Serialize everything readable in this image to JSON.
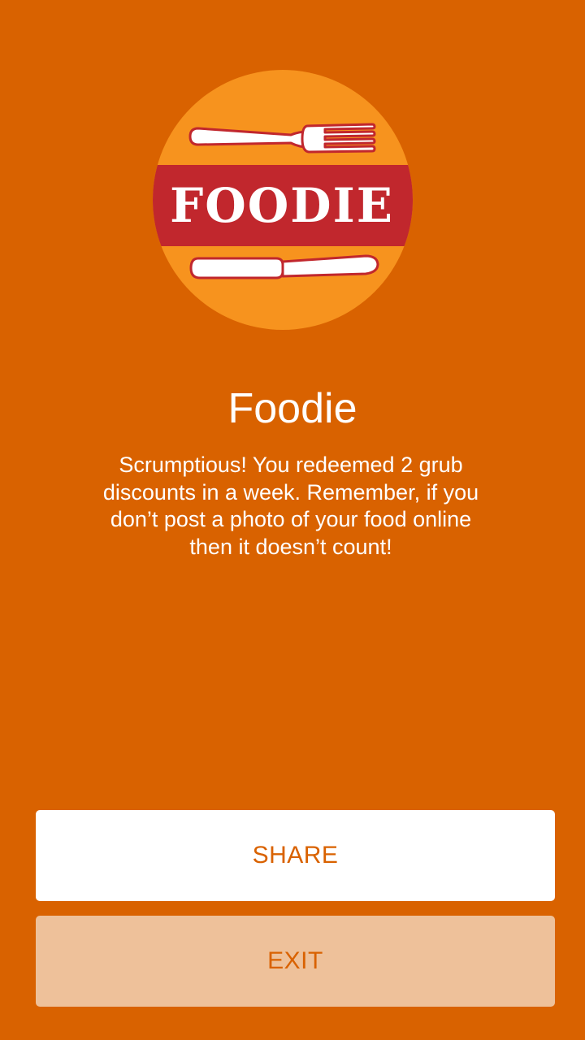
{
  "badge": {
    "logo_text": "FOODIE",
    "colors": {
      "circle": "#f7931e",
      "band": "#c1272d",
      "utensil_fill": "#ffffff",
      "utensil_outline": "#c1272d"
    },
    "icons": [
      "fork-icon",
      "knife-icon"
    ]
  },
  "achievement": {
    "title": "Foodie",
    "message": "Scrumptious! You redeemed 2 grub discounts in a week. Remember, if you don’t post a photo of your food online then it doesn’t count!"
  },
  "actions": {
    "share_label": "SHARE",
    "exit_label": "EXIT"
  },
  "theme": {
    "background": "#d96200",
    "accent_text": "#d96200",
    "share_bg": "#ffffff",
    "exit_bg": "#eec19a"
  }
}
